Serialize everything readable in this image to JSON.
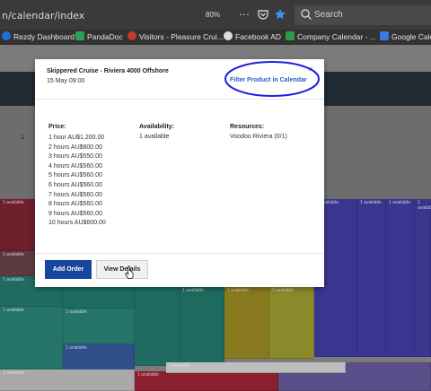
{
  "browser": {
    "url": "n/calendar/index",
    "zoom": "80%",
    "menu_icon": "ellipsis-icon",
    "search_placeholder": "Search",
    "bookmarks": [
      {
        "label": "Rezdy Dashboard",
        "color": "#1f6fd6"
      },
      {
        "label": "PandaDoc",
        "color": "#2aa35a"
      },
      {
        "label": "Visitors - Pleasure Crui...",
        "color": "#c0392b"
      },
      {
        "label": "Facebook AD",
        "color": "#dddddd"
      },
      {
        "label": "Company Calendar - ...",
        "color": "#2a9d48"
      },
      {
        "label": "Google Cale",
        "color": "#3b78e7"
      }
    ]
  },
  "background_app": {
    "pager_text": "1",
    "cell_label": "1 available"
  },
  "modal": {
    "title": "Skippered Cruise - Riviera 4000 Offshore",
    "date": "15 May 09:00",
    "filter_link": "Filter Product in Calendar",
    "close": "×",
    "price": {
      "label": "Price:",
      "rows": [
        "1 hour AU$1,200.00",
        "2 hours AU$600.00",
        "3 hours AU$550.00",
        "4 hours AU$560.00",
        "5 hours AU$560.00",
        "6 hours AU$560.00",
        "7 hours AU$560.00",
        "8 hours AU$560.00",
        "9 hours AU$560.00",
        "10 hours AU$600.00"
      ]
    },
    "availability": {
      "label": "Availability:",
      "value": "1 available"
    },
    "resources": {
      "label": "Resources:",
      "value": "Voodoo Riviera (0/1)"
    },
    "buttons": {
      "add_order": "Add Order",
      "view_details": "View Details"
    },
    "colors": {
      "primary": "#17469e",
      "link": "#2463c7",
      "annotation": "#1d1ee0"
    }
  }
}
